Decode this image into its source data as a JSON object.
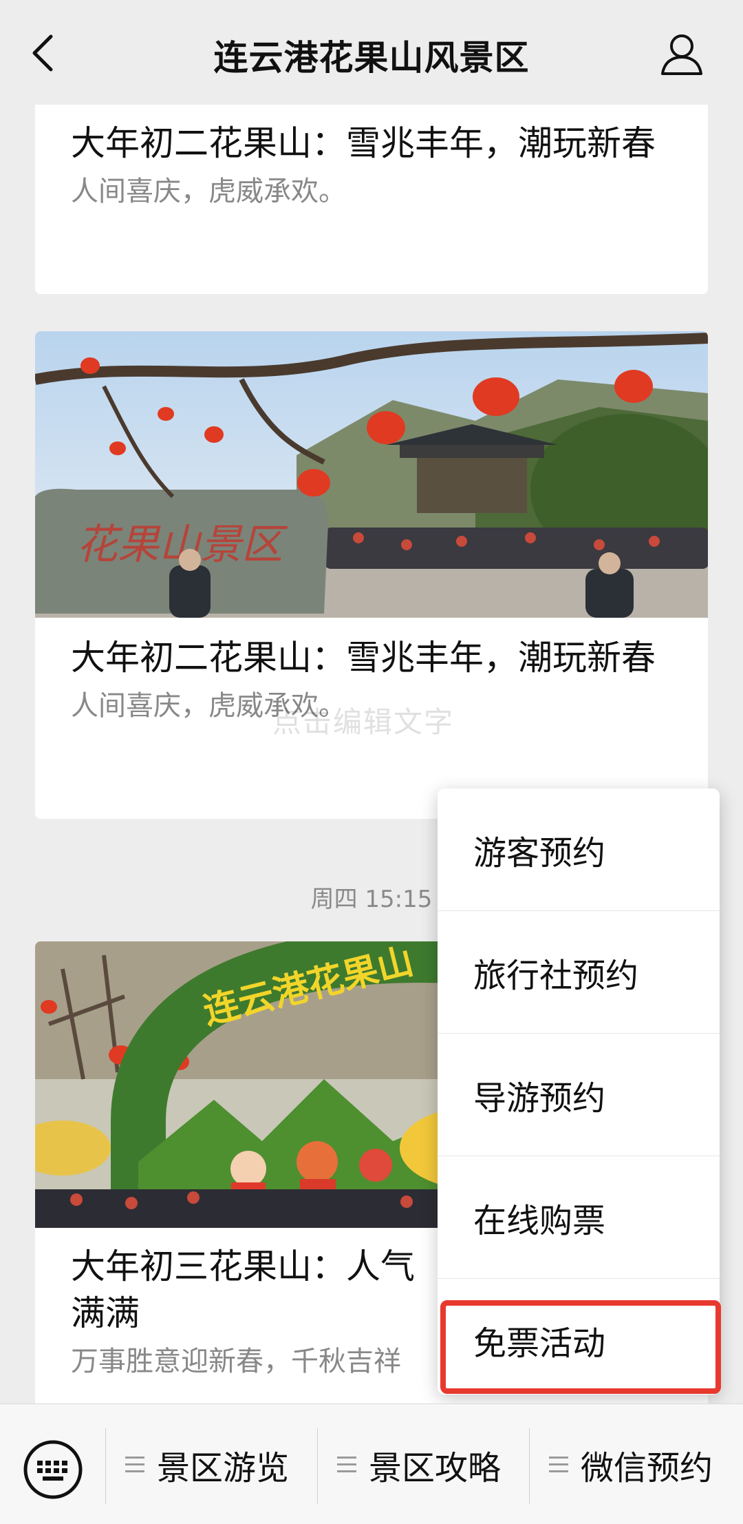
{
  "header": {
    "title": "连云港花果山风景区"
  },
  "cards": [
    {
      "title": "大年初二花果山：雪兆丰年，潮玩新春",
      "desc": "人间喜庆，虎威承欢。"
    },
    {
      "title": "大年初二花果山：雪兆丰年，潮玩新春",
      "desc": "人间喜庆，虎威承欢。",
      "image_text": "花果山景区"
    },
    {
      "title": "大年初三花果山：人气满满",
      "desc": "万事胜意迎新春，千秋吉祥",
      "image_text": "连云港花果山"
    }
  ],
  "watermark": "点击编辑文字",
  "timestamp": "周四 15:15",
  "popup_menu": {
    "items": [
      "游客预约",
      "旅行社预约",
      "导游预约",
      "在线购票",
      "免票活动"
    ],
    "highlight_color": "#e8392f"
  },
  "bottom_menu": {
    "tabs": [
      "景区游览",
      "景区攻略",
      "微信预约"
    ]
  },
  "icons": {
    "back": "back-arrow-icon",
    "profile": "user-icon",
    "keyboard": "keyboard-icon",
    "menu": "menu-lines-icon"
  }
}
